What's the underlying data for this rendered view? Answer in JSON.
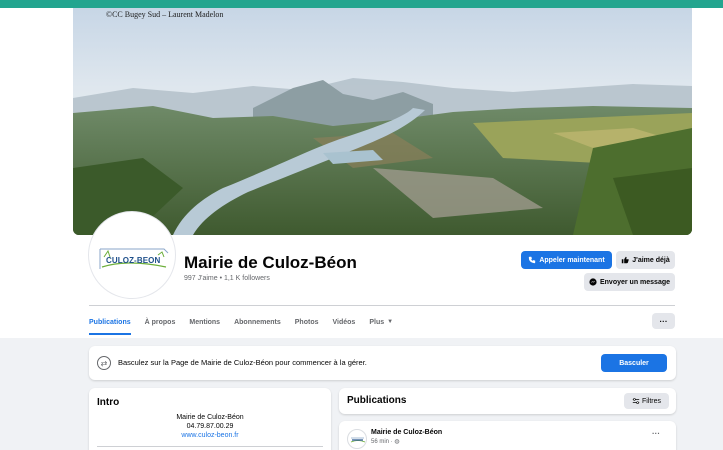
{
  "cover": {
    "credit": "©CC Bugey Sud – Laurent Madelon"
  },
  "profile": {
    "logo_text": "CULOZ-BEON",
    "name": "Mairie de Culoz-Béon",
    "stats": "997 J'aime • 1,1 K followers"
  },
  "actions": {
    "call_label": "Appeler maintenant",
    "like_label": "J'aime déjà",
    "message_label": "Envoyer un message"
  },
  "tabs": [
    {
      "label": "Publications",
      "active": true
    },
    {
      "label": "À propos"
    },
    {
      "label": "Mentions"
    },
    {
      "label": "Abonnements"
    },
    {
      "label": "Photos"
    },
    {
      "label": "Vidéos"
    },
    {
      "label": "Plus"
    }
  ],
  "more_label": "···",
  "banner": {
    "text": "Basculez sur la Page de Mairie de Culoz-Béon pour commencer à la gérer.",
    "button": "Basculer"
  },
  "intro": {
    "title": "Intro",
    "name": "Mairie de Culoz-Béon",
    "phone": "04.79.87.00.29",
    "website": "www.culoz-beon.fr"
  },
  "publications": {
    "title": "Publications",
    "filter_label": "Filtres",
    "post": {
      "author": "Mairie de Culoz-Béon",
      "time": "56 min ·",
      "more": "···"
    }
  },
  "colors": {
    "accent": "#1b74e4",
    "topbar": "#23a58f"
  }
}
